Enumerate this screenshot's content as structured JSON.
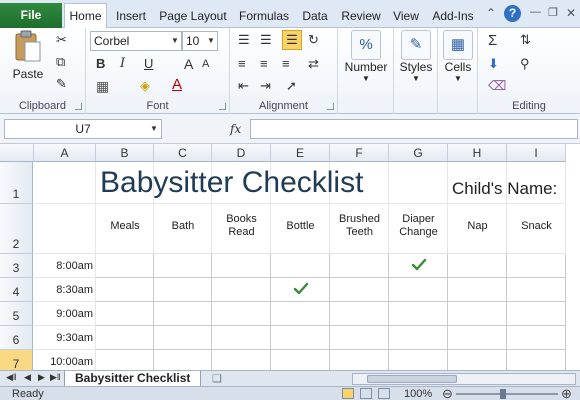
{
  "ribbon": {
    "file_label": "File",
    "tabs": [
      "Home",
      "Insert",
      "Page Layout",
      "Formulas",
      "Data",
      "Review",
      "View",
      "Add-Ins"
    ],
    "active_tab": "Home",
    "help_icon": "?",
    "groups": {
      "clipboard": "Clipboard",
      "font": "Font",
      "alignment": "Alignment",
      "number": "Number",
      "styles": "Styles",
      "cells": "Cells",
      "editing": "Editing"
    },
    "paste_label": "Paste",
    "font_name": "Corbel",
    "font_size": "10",
    "number_label": "Number",
    "styles_label": "Styles",
    "cells_label": "Cells",
    "bold": "B",
    "italic": "I",
    "underline": "U",
    "grow_font": "A",
    "shrink_font": "A",
    "font_color_letter": "A"
  },
  "formula_bar": {
    "name_box": "U7",
    "fx_label": "fx",
    "formula": ""
  },
  "grid": {
    "columns": [
      "A",
      "B",
      "C",
      "D",
      "E",
      "F",
      "G",
      "H",
      "I"
    ],
    "rows": [
      "1",
      "2",
      "3",
      "4",
      "5",
      "6",
      "7"
    ],
    "selected_row": "7",
    "title": "Babysitter Checklist",
    "child_label": "Child's Name:",
    "headers": [
      "Meals",
      "Bath",
      "Books Read",
      "Bottle",
      "Brushed Teeth",
      "Diaper Change",
      "Nap",
      "Snack"
    ],
    "times": [
      "8:00am",
      "8:30am",
      "9:00am",
      "9:30am",
      "10:00am"
    ],
    "checks": [
      {
        "time": "8:00am",
        "column": "Diaper Change"
      },
      {
        "time": "8:30am",
        "column": "Bottle"
      }
    ]
  },
  "sheet_tabs": {
    "active": "Babysitter Checklist"
  },
  "status_bar": {
    "status": "Ready",
    "zoom": "100%"
  },
  "colors": {
    "file_tab": "#2e8b3e",
    "title_text": "#1f3b55",
    "checkmark": "#3a8a3a",
    "selected_row_header": "#f9d983"
  }
}
